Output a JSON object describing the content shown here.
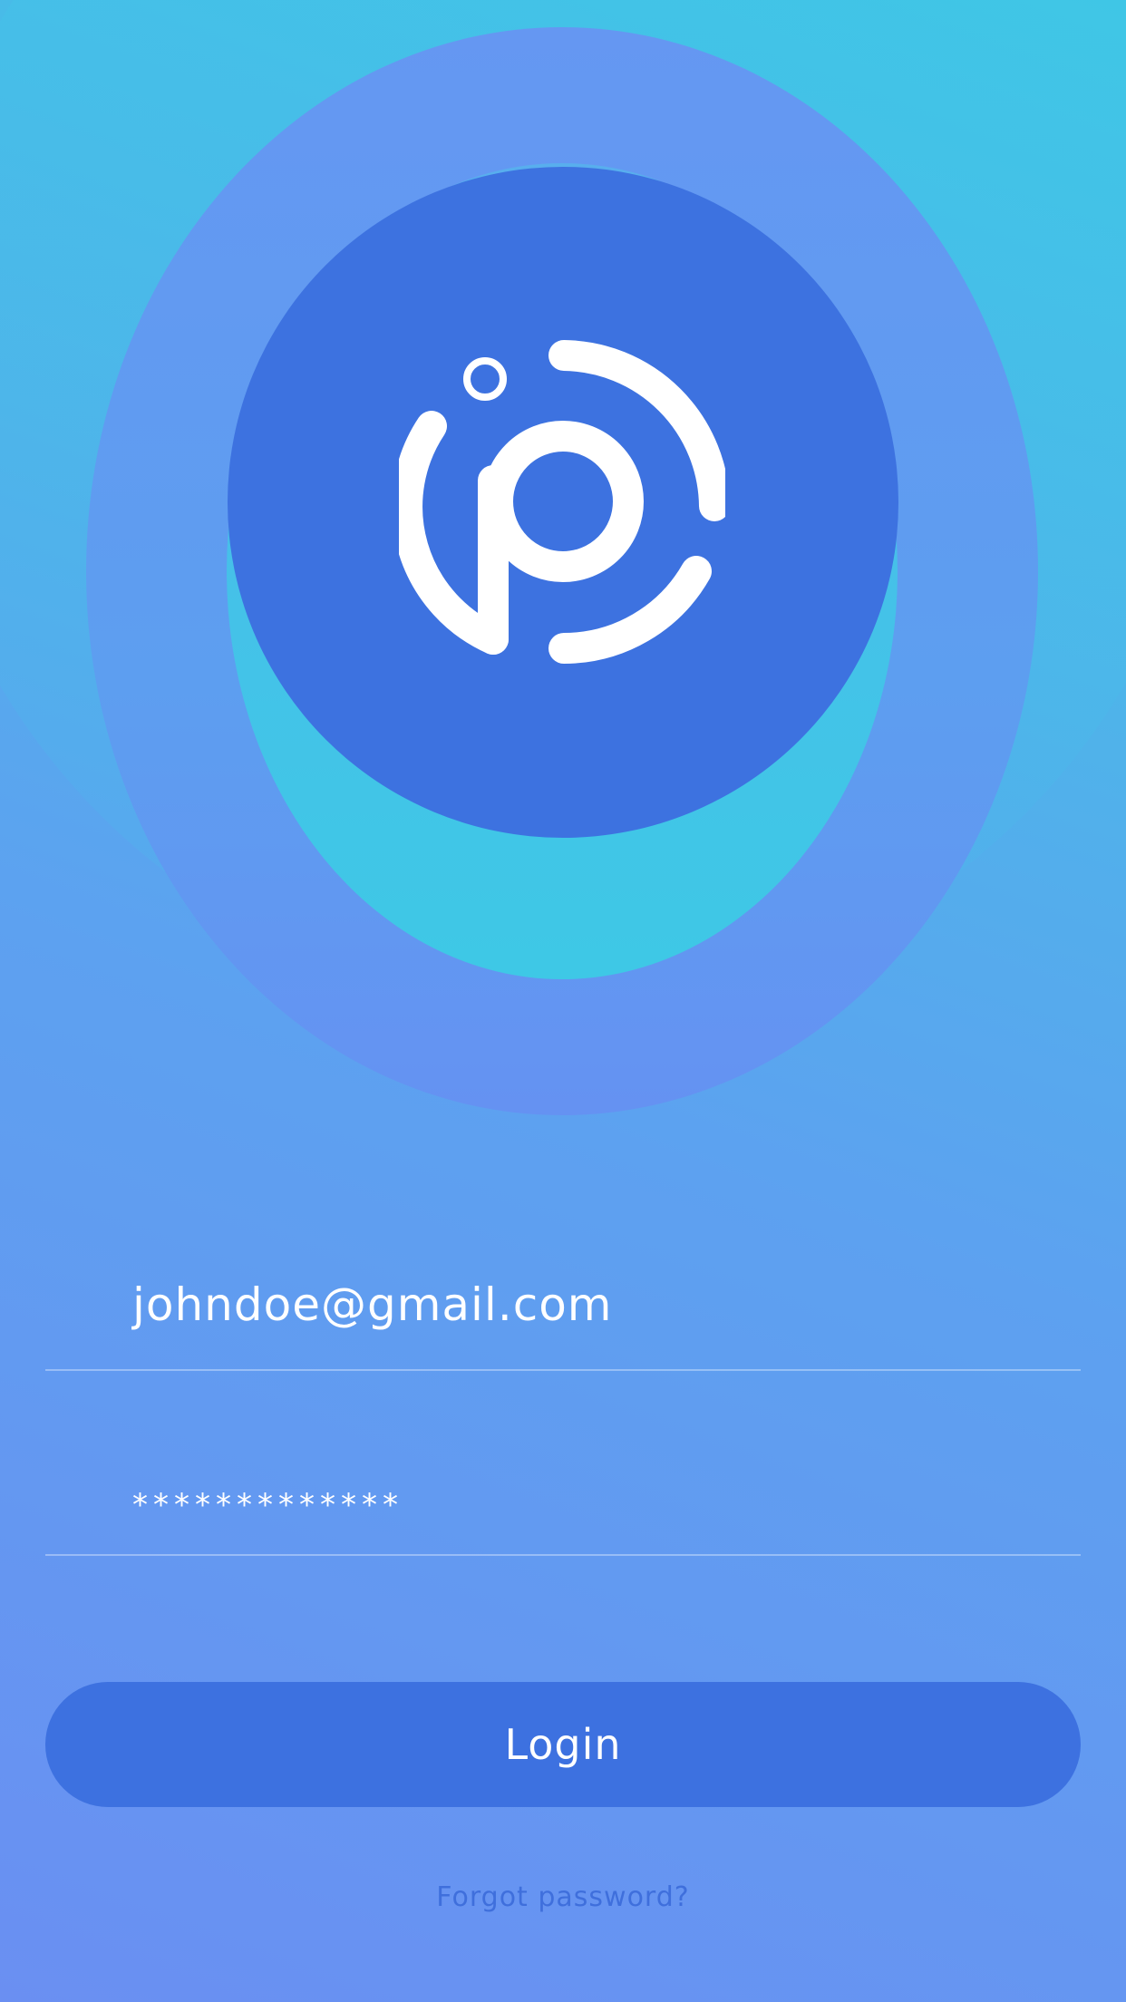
{
  "logo": {
    "icon": "ip-logo-icon"
  },
  "login_form": {
    "email_value": "johndoe@gmail.com",
    "password_value": "*************"
  },
  "actions": {
    "login_label": "Login",
    "forgot_password_label": "Forgot password?"
  },
  "colors": {
    "primary": "#3d72e0",
    "text_on_primary": "#ffffff",
    "link": "#3f6fdc",
    "accent_cyan": "#3ec8e6"
  }
}
